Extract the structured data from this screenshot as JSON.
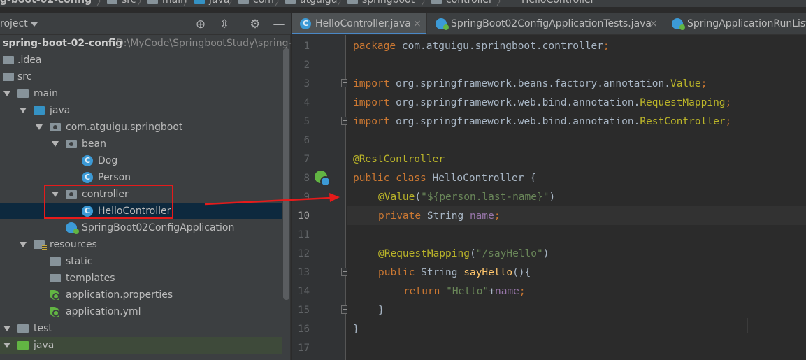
{
  "breadcrumb": {
    "items": [
      "g-boot-02-config",
      "src",
      "main",
      "java",
      "com",
      "atguigu",
      "springboot",
      "controller",
      "HelloController"
    ]
  },
  "project_panel": {
    "title": "roject",
    "icons": [
      "crosshair-icon",
      "collapse-icon",
      "gear-icon",
      "minimize-icon"
    ],
    "tree": [
      {
        "label": "spring-boot-02-config",
        "path": "D:\\MyCode\\SpringbootStudy\\spring-",
        "icon": "module"
      },
      {
        "label": ".idea",
        "icon": "folder"
      },
      {
        "label": "src",
        "icon": "folder"
      },
      {
        "label": "main",
        "icon": "folder",
        "expanded": true
      },
      {
        "label": "java",
        "icon": "source-folder",
        "expanded": true
      },
      {
        "label": "com.atguigu.springboot",
        "icon": "package",
        "expanded": true
      },
      {
        "label": "bean",
        "icon": "package",
        "expanded": true
      },
      {
        "label": "Dog",
        "icon": "class"
      },
      {
        "label": "Person",
        "icon": "class"
      },
      {
        "label": "controller",
        "icon": "package",
        "expanded": true
      },
      {
        "label": "HelloController",
        "icon": "class",
        "selected": true
      },
      {
        "label": "SpringBoot02ConfigApplication",
        "icon": "spring-boot-class"
      },
      {
        "label": "resources",
        "icon": "resources-folder",
        "expanded": true
      },
      {
        "label": "static",
        "icon": "folder"
      },
      {
        "label": "templates",
        "icon": "folder"
      },
      {
        "label": "application.properties",
        "icon": "spring-config"
      },
      {
        "label": "application.yml",
        "icon": "spring-config"
      },
      {
        "label": "test",
        "icon": "folder",
        "expanded": true
      },
      {
        "label": "java",
        "icon": "test-source-folder",
        "expanded": true
      }
    ]
  },
  "editor": {
    "tabs": [
      {
        "label": "HelloController.java",
        "active": true,
        "close": "×"
      },
      {
        "label": "SpringBoot02ConfigApplicationTests.java",
        "active": false,
        "close": "×"
      },
      {
        "label": "SpringApplicationRunList",
        "active": false
      }
    ],
    "current_line": 10,
    "line_numbers": [
      "1",
      "2",
      "3",
      "4",
      "5",
      "6",
      "7",
      "8",
      "9",
      "10",
      "11",
      "12",
      "13",
      "14",
      "15",
      "16",
      "17"
    ],
    "code": {
      "l1_package": "package",
      "l1_rest": " com.atguigu.springboot.controller",
      "l1_semi": ";",
      "import_kw": "import",
      "l3_pkg": " org.springframework.beans.factory.annotation.",
      "l3_cls": "Value",
      "l4_pkg": " org.springframework.web.bind.annotation.",
      "l4_cls": "RequestMapping",
      "l5_pkg": " org.springframework.web.bind.annotation.",
      "l5_cls": "RestController",
      "semi": ";",
      "l7_ann": "@RestController",
      "l8_kw": "public class",
      "l8_rest": " HelloController {",
      "l9_ann": "@Value",
      "l9_open": "(",
      "l9_str": "\"${person.last-name}\"",
      "l9_close": ")",
      "l10_kw": "private",
      "l10_type": " String ",
      "l10_field": "name",
      "l12_ann": "@RequestMapping",
      "l12_open": "(",
      "l12_str": "\"/sayHello\"",
      "l12_close": ")",
      "l13_kw": "public",
      "l13_type": " String ",
      "l13_fn": "sayHello",
      "l13_rest": "(){",
      "l14_kw": "return",
      "l14_str": " \"Hello\"",
      "l14_plus": "+",
      "l14_field": "name",
      "l15_close": "}",
      "l16_close": "}"
    }
  },
  "annotation_colors": {
    "highlight_box": "#e51b1b",
    "arrow": "#e51b1b"
  }
}
